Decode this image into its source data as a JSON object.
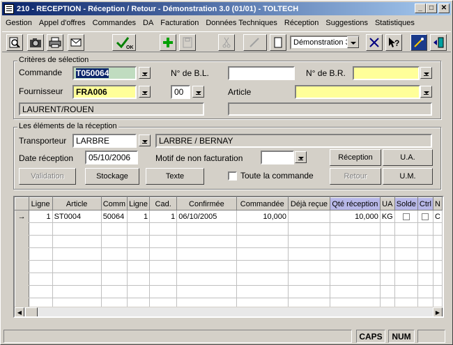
{
  "window": {
    "title": "210 - RECEPTION - Réception / Retour - Démonstration 3.0 (01/01) - TOLTECH"
  },
  "menu": [
    "Gestion",
    "Appel d'offres",
    "Commandes",
    "DA",
    "Facturation",
    "Données Techniques",
    "Réception",
    "Suggestions",
    "Statistiques"
  ],
  "toolbar": {
    "company_select": "Démonstration 3"
  },
  "criteria": {
    "group_title": "Critères de sélection",
    "commande_label": "Commande",
    "commande_value": "T050064",
    "bl_label": "N° de B.L.",
    "bl_value": "",
    "br_label": "N° de B.R.",
    "br_value": "",
    "fournisseur_label": "Fournisseur",
    "fournisseur_value": "FRA006",
    "index_value": "00",
    "article_label": "Article",
    "article_value": "",
    "supplier_name": "LAURENT/ROUEN",
    "article_desc": ""
  },
  "reception": {
    "group_title": "Les éléments de la réception",
    "transporteur_label": "Transporteur",
    "transporteur_value": "LARBRE",
    "transporteur_name": "LARBRE / BERNAY",
    "date_label": "Date réception",
    "date_value": "05/10/2006",
    "motif_label": "Motif de non facturation",
    "motif_value": "",
    "toute_label": "Toute la commande",
    "btn_reception": "Réception",
    "btn_ua": "U.A.",
    "btn_validation": "Validation",
    "btn_stockage": "Stockage",
    "btn_texte": "Texte",
    "btn_retour": "Retour",
    "btn_um": "U.M."
  },
  "grid": {
    "columns": [
      "Ligne",
      "Article",
      "Comm",
      "Ligne",
      "Cad.",
      "Confirmée",
      "Commandée",
      "Déjà reçue",
      "Qté réception",
      "UA",
      "Solde",
      "Ctrl",
      "N"
    ],
    "rows": [
      {
        "marker": "→",
        "ligne": "1",
        "article": "ST0004",
        "comm": "50064",
        "ligne2": "1",
        "cad": "1",
        "confirmee": "06/10/2005",
        "commandee": "10,000",
        "deja": "",
        "qte": "10,000",
        "ua": "KG",
        "extra": "C"
      }
    ]
  },
  "status": {
    "caps": "CAPS",
    "num": "NUM"
  }
}
